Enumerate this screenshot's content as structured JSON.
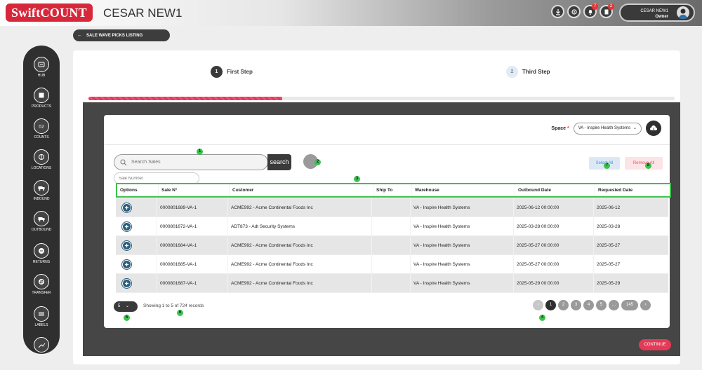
{
  "app": {
    "logo": "SwiftCOUNT",
    "company": "CESAR NEW1"
  },
  "header": {
    "badges": [
      "7",
      "2"
    ],
    "user_name": "CESAR NEW1",
    "user_role": "Owner"
  },
  "breadcrumb": "SALE WAVE PICKS LISTING",
  "sidebar": {
    "items": [
      {
        "label": "HUB",
        "icon": "hub-icon"
      },
      {
        "label": "PRODUCTS",
        "icon": "box-icon"
      },
      {
        "label": "COUNTS",
        "icon": "counts-icon"
      },
      {
        "label": "LOCATIONS",
        "icon": "location-icon"
      },
      {
        "label": "INBOUND",
        "icon": "truck-icon"
      },
      {
        "label": "OUTBOUND",
        "icon": "truck-icon"
      },
      {
        "label": "RETURNS",
        "icon": "returns-icon"
      },
      {
        "label": "TRANSFER",
        "icon": "transfer-icon"
      },
      {
        "label": "LABELS",
        "icon": "labels-icon"
      }
    ]
  },
  "steps": [
    {
      "num": "1",
      "label": "First Step"
    },
    {
      "num": "2",
      "label": "Third Step"
    }
  ],
  "progress": 0.33,
  "space": {
    "label": "Space",
    "required": "*",
    "value": "VA - Inspire Health Systems"
  },
  "search": {
    "placeholder": "Search Sales",
    "button": "search",
    "sale_number_placeholder": "Sale Number"
  },
  "actions": {
    "select_all": "Select All",
    "remove_all": "Remove All"
  },
  "markers": [
    "1",
    "2",
    "3",
    "4",
    "5",
    "6",
    "7",
    "8",
    "9"
  ],
  "table": {
    "columns": [
      "Options",
      "Sale N°",
      "Customer",
      "Ship To",
      "Warehouse",
      "Outbound Date",
      "Requested Date"
    ],
    "rows": [
      {
        "sale": "0000801689-VA-1",
        "customer": "ACME992 - Acme Continental Foods Inc",
        "ship_to": "",
        "warehouse": "VA - Inspire Health Systems",
        "outbound": "2025-06-12 00:00:00",
        "requested": "2025-06-12"
      },
      {
        "sale": "0000801672-VA-1",
        "customer": "ADT873 - Adt Security Systems",
        "ship_to": "",
        "warehouse": "VA - Inspire Health Systems",
        "outbound": "2025-03-28 00:00:00",
        "requested": "2025-03-28"
      },
      {
        "sale": "0000801684-VA-1",
        "customer": "ACME992 - Acme Continental Foods Inc",
        "ship_to": "",
        "warehouse": "VA - Inspire Health Systems",
        "outbound": "2025-05-27 00:00:00",
        "requested": "2025-05-27"
      },
      {
        "sale": "0000801685-VA-1",
        "customer": "ACME992 - Acme Continental Foods Inc",
        "ship_to": "",
        "warehouse": "VA - Inspire Health Systems",
        "outbound": "2025-05-27 00:00:00",
        "requested": "2025-05-27"
      },
      {
        "sale": "0000801687-VA-1",
        "customer": "ACME992 - Acme Continental Foods Inc",
        "ship_to": "",
        "warehouse": "VA - Inspire Health Systems",
        "outbound": "2025-05-29 00:00:00",
        "requested": "2025-05-29"
      }
    ]
  },
  "pagination": {
    "per_page": "5",
    "showing": "Showing 1 to 5 of 724 records",
    "pages": [
      "1",
      "2",
      "3",
      "4",
      "5",
      "...",
      "145"
    ]
  },
  "continue": "CONTINUE"
}
